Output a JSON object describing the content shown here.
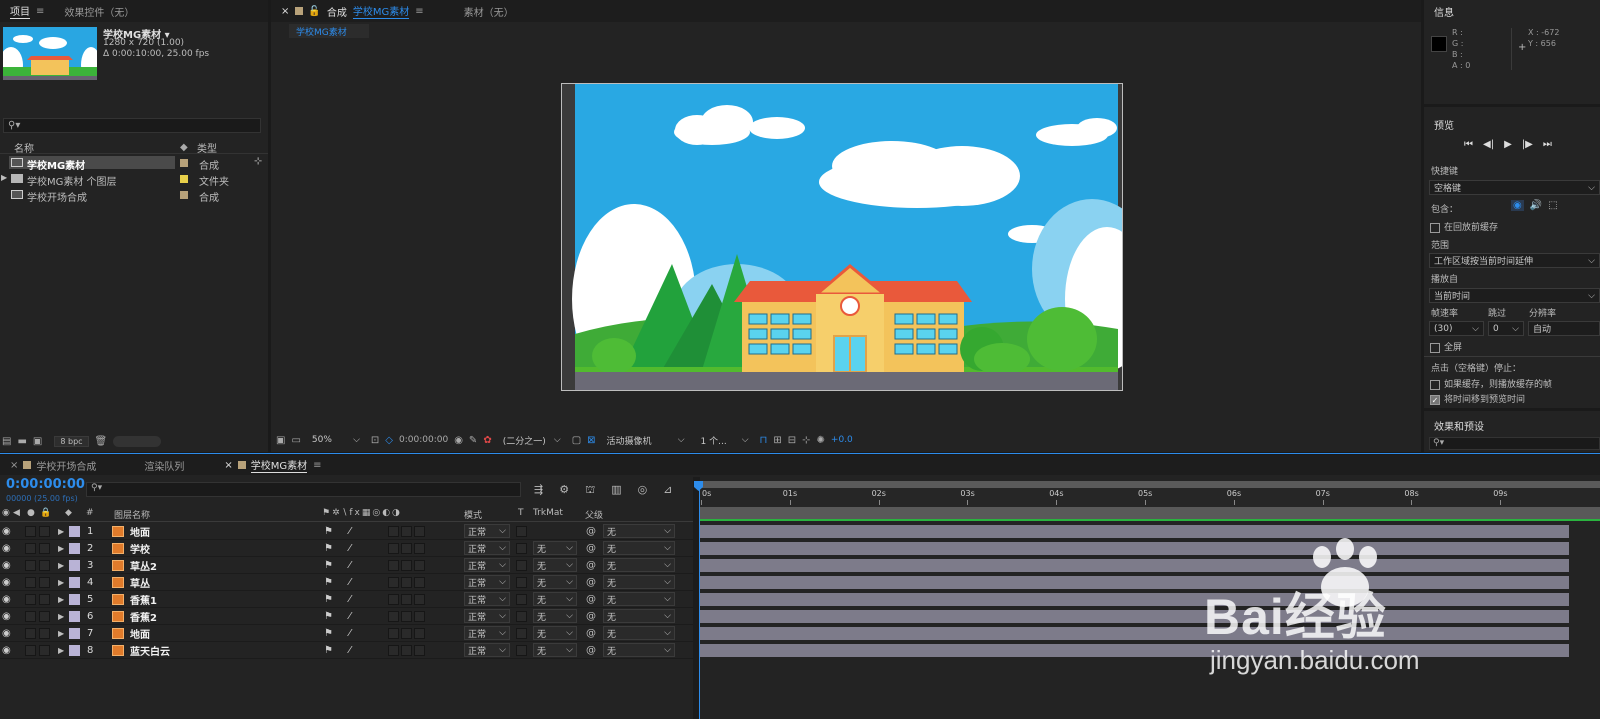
{
  "project_panel": {
    "tabs": [
      {
        "label": "项目"
      },
      {
        "label": "效果控件（无）"
      }
    ],
    "comp_name": "学校MG素材 ▾",
    "comp_size": "1280 x 720 (1.00)",
    "comp_duration": "Δ 0:00:10:00, 25.00 fps",
    "search_placeholder": "",
    "columns": {
      "name": "名称",
      "type": "类型"
    },
    "items": [
      {
        "name": "学校MG素材",
        "type": "合成",
        "selected": true
      },
      {
        "name": "学校MG素材 个图层",
        "type": "文件夹"
      },
      {
        "name": "学校开场合成",
        "type": "合成"
      }
    ],
    "bpc": "8 bpc"
  },
  "comp_viewer": {
    "tabs": [
      {
        "label": "合成"
      },
      {
        "label": "学校MG素材"
      },
      {
        "label": "素材（无）"
      }
    ],
    "sub_tab": "学校MG素材",
    "zoom": "50%",
    "timecode": "0:00:00:00",
    "resolution": "(二分之一)",
    "camera": "活动摄像机",
    "views": "1 个...",
    "exposure": "+0.0"
  },
  "info_panel": {
    "title": "信息",
    "rgba": [
      "R :",
      "G :",
      "B :",
      "A : 0"
    ],
    "x": "X : -672",
    "y": "Y : 656"
  },
  "preview_panel": {
    "title": "预览",
    "shortcut_label": "快捷键",
    "shortcut_value": "空格键",
    "include_label": "包含：",
    "cache_before": "在回放前缓存",
    "range_label": "范围",
    "range_value": "工作区域按当前时间延伸",
    "play_from_label": "播放自",
    "play_from_value": "当前时间",
    "fps_label": "帧速率",
    "skip_label": "跳过",
    "res_label": "分辨率",
    "fps_value": "(30)",
    "skip_value": "0",
    "res_value": "自动",
    "fullscreen": "全屏",
    "stop_label": "点击（空格键）停止：",
    "if_cached": "如果缓存，则播放缓存的帧",
    "move_time": "将时间移到预览时间",
    "effects_title": "效果和预设"
  },
  "timeline": {
    "tabs": [
      {
        "label": "学校开场合成"
      },
      {
        "label": "渲染队列"
      },
      {
        "label": "学校MG素材"
      }
    ],
    "timecode": "0:00:00:00",
    "frames": "00000 (25.00 fps)",
    "headers": {
      "num": "#",
      "layer_name": "图层名称",
      "mode": "模式",
      "t": "T",
      "trkmat": "TrkMat",
      "parent": "父级"
    },
    "ruler": [
      "0s",
      "01s",
      "02s",
      "03s",
      "04s",
      "05s",
      "06s",
      "07s",
      "08s",
      "09s"
    ],
    "layers": [
      {
        "num": "1",
        "name": "地面",
        "mode": "正常",
        "trkmat": "",
        "parent": "无"
      },
      {
        "num": "2",
        "name": "学校",
        "mode": "正常",
        "trkmat": "无",
        "parent": "无"
      },
      {
        "num": "3",
        "name": "草丛2",
        "mode": "正常",
        "trkmat": "无",
        "parent": "无"
      },
      {
        "num": "4",
        "name": "草丛",
        "mode": "正常",
        "trkmat": "无",
        "parent": "无"
      },
      {
        "num": "5",
        "name": "香蕉1",
        "mode": "正常",
        "trkmat": "无",
        "parent": "无"
      },
      {
        "num": "6",
        "name": "香蕉2",
        "mode": "正常",
        "trkmat": "无",
        "parent": "无"
      },
      {
        "num": "7",
        "name": "地面",
        "mode": "正常",
        "trkmat": "无",
        "parent": "无"
      },
      {
        "num": "8",
        "name": "蓝天白云",
        "mode": "正常",
        "trkmat": "无",
        "parent": "无"
      }
    ]
  },
  "watermark": {
    "text": "Bai经验",
    "url": "jingyan.baidu.com"
  },
  "colors": {
    "accent": "#2d8ceb",
    "panel": "#232323",
    "bar": "#7d7b8a",
    "label": "#b9b3d6"
  }
}
